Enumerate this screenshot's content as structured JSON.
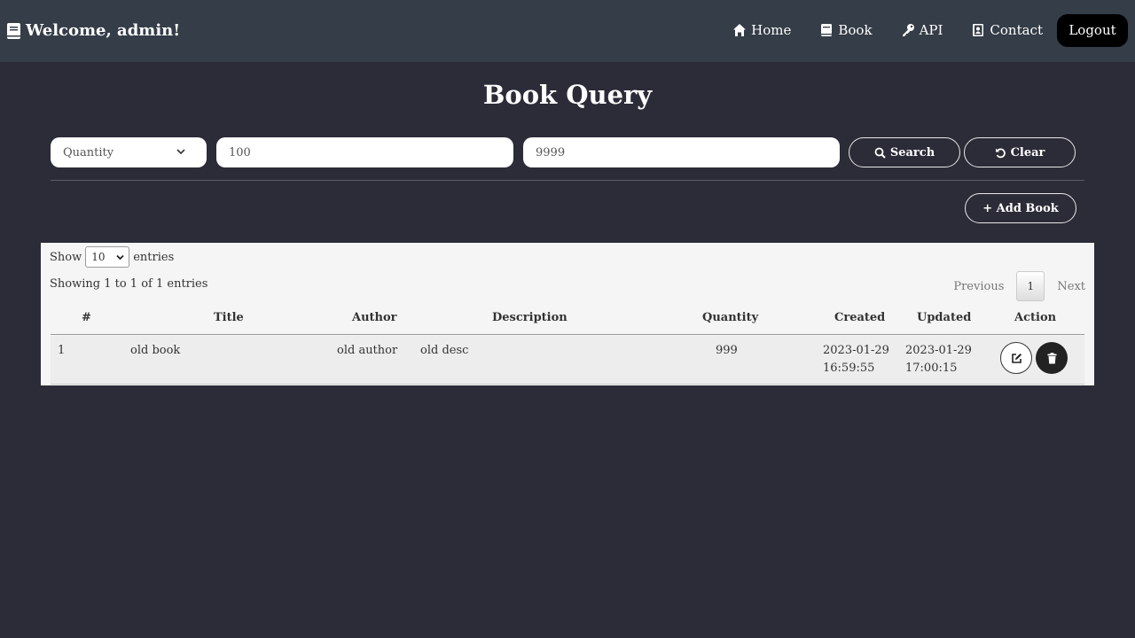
{
  "navbar": {
    "brand": "Welcome, admin!",
    "links": [
      {
        "label": "Home",
        "icon": "home-icon"
      },
      {
        "label": "Book",
        "icon": "book-icon"
      },
      {
        "label": "API",
        "icon": "key-icon"
      },
      {
        "label": "Contact",
        "icon": "contact-icon"
      }
    ],
    "logout": "Logout"
  },
  "page": {
    "title": "Book Query"
  },
  "search": {
    "field": "Quantity",
    "min_value": "100",
    "max_value": "9999",
    "search_label": "Search",
    "clear_label": "Clear",
    "add_label": "+ Add Book"
  },
  "table": {
    "show_label": "Show",
    "page_size": "10",
    "entries_label": "entries",
    "info": "Showing 1 to 1 of 1 entries",
    "previous": "Previous",
    "current_page": "1",
    "next": "Next",
    "headers": [
      "#",
      "Title",
      "Author",
      "Description",
      "Quantity",
      "Created",
      "Updated",
      "Action"
    ],
    "rows": [
      {
        "num": "1",
        "title": "old book",
        "author": "old author",
        "description": "old desc",
        "quantity": "999",
        "created_date": "2023-01-29",
        "created_time": "16:59:55",
        "updated_date": "2023-01-29",
        "updated_time": "17:00:15"
      }
    ]
  },
  "colors": {
    "background": "#2c2b38",
    "navbar": "#343d48",
    "panel": "#f5f5f6"
  }
}
